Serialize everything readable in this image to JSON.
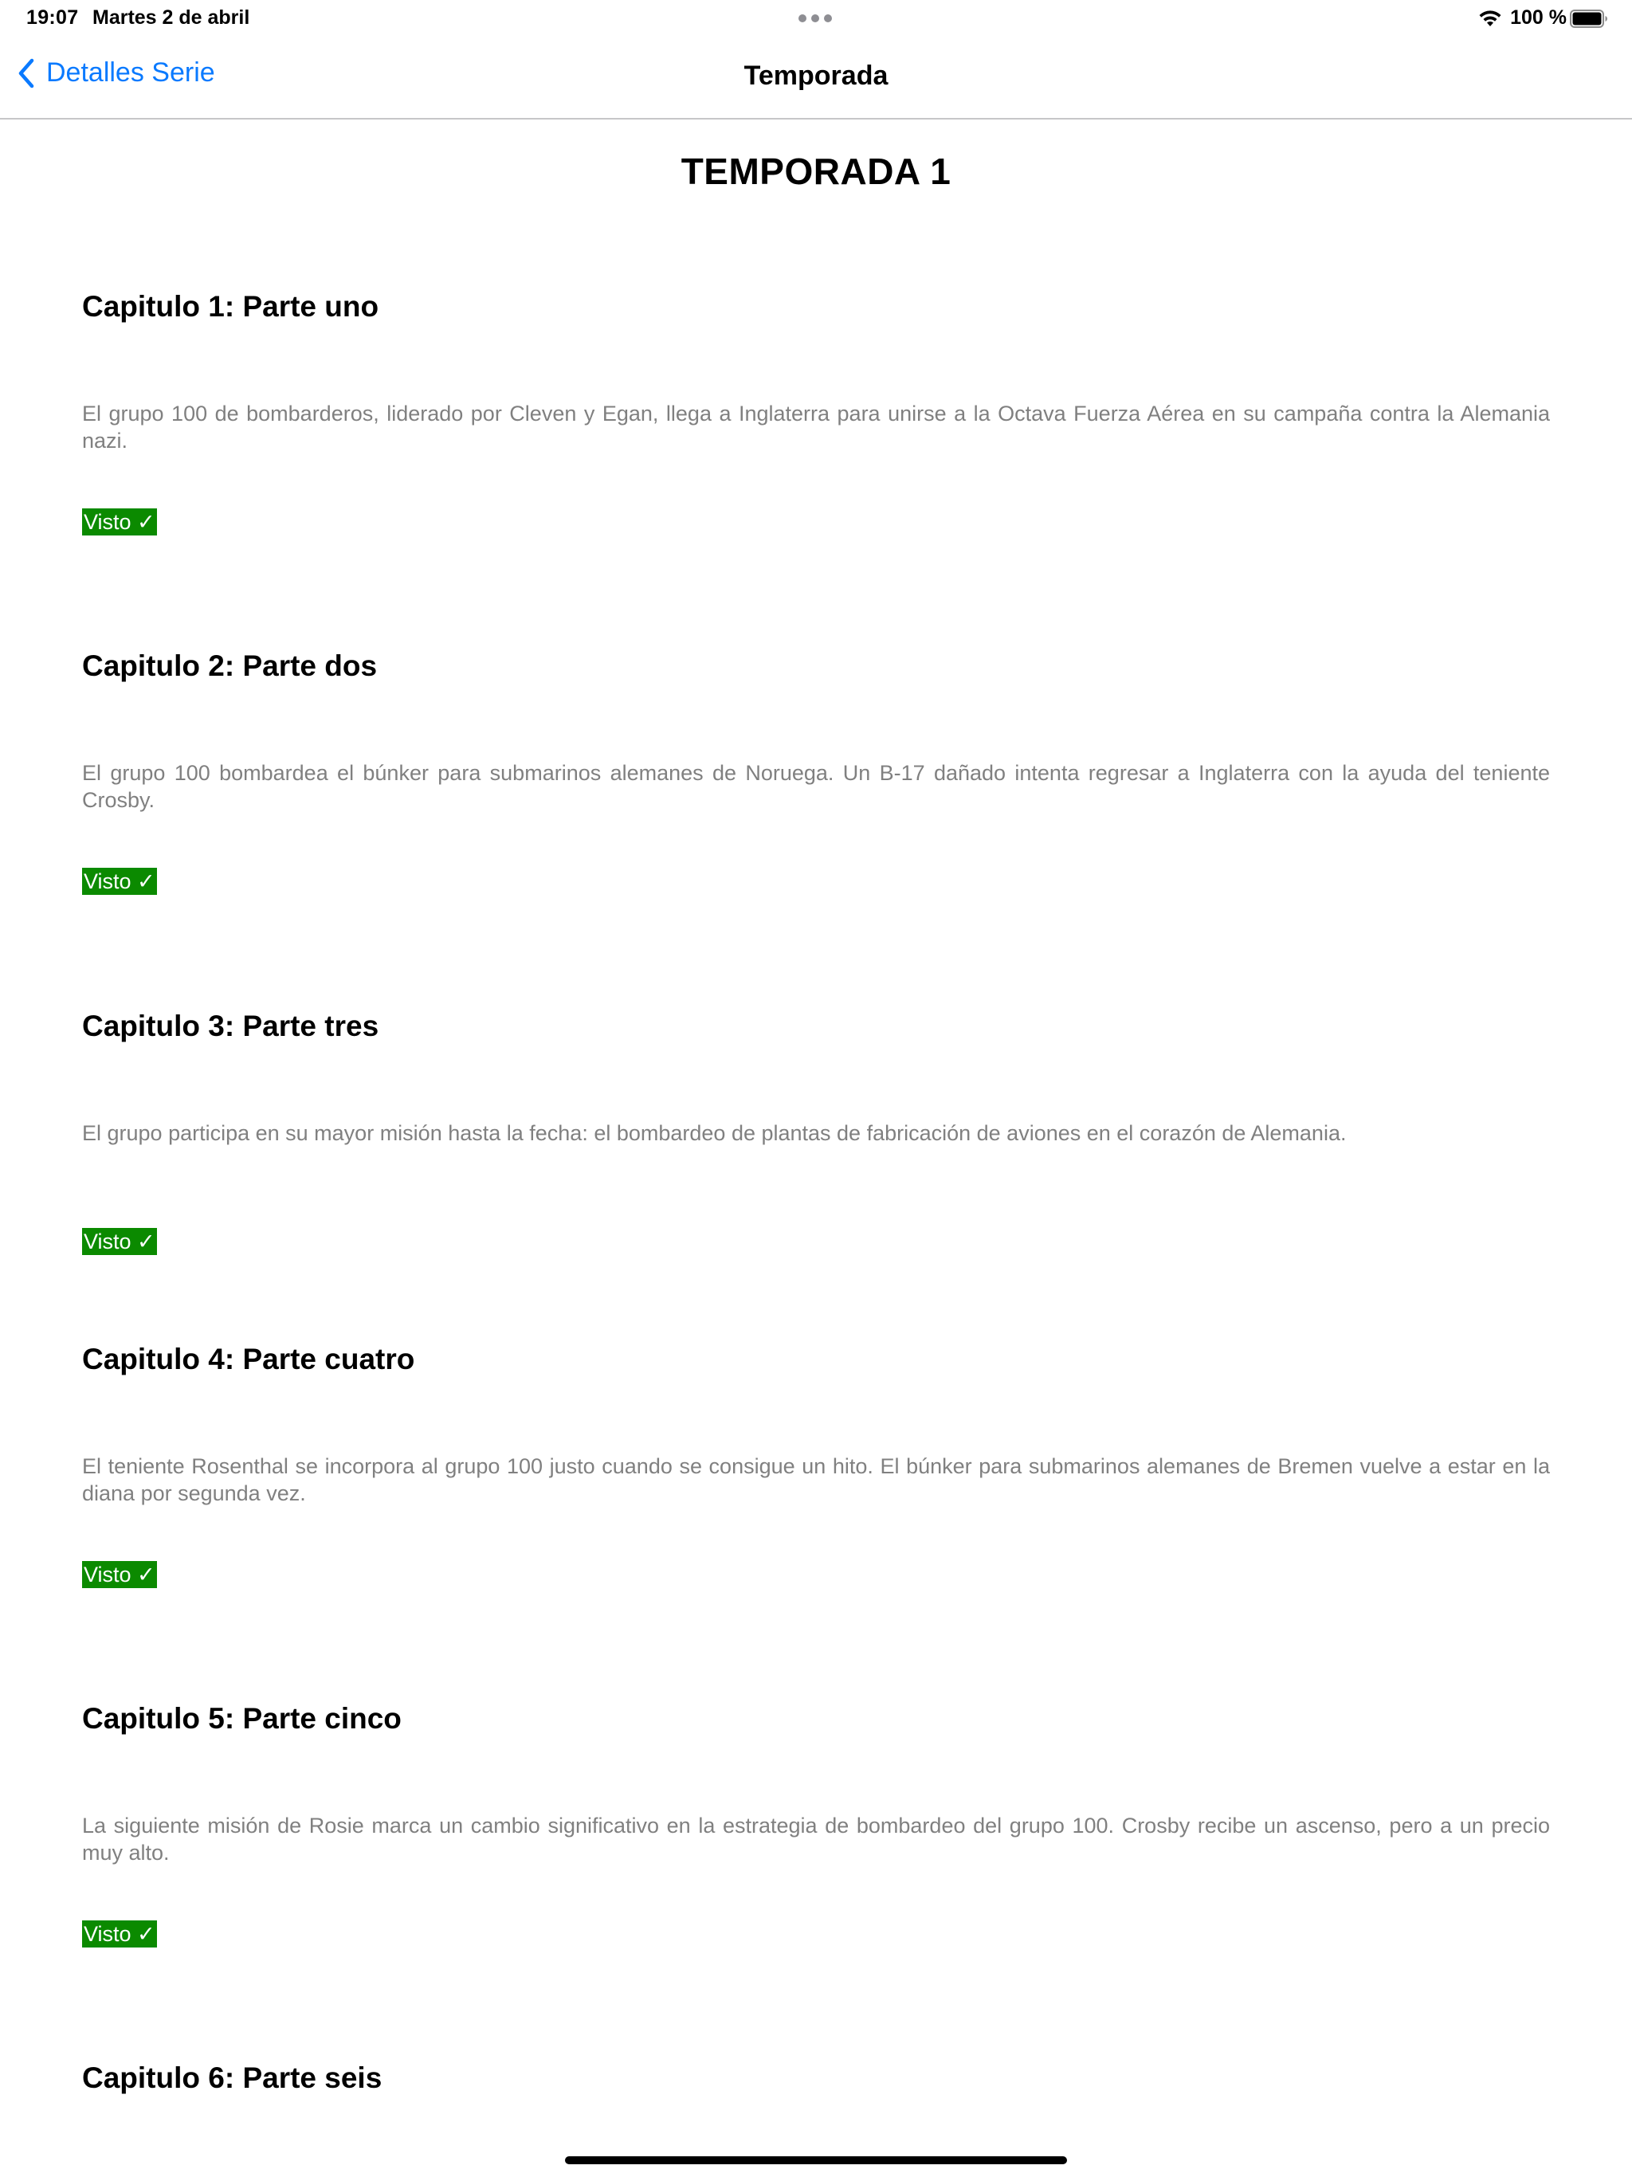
{
  "status_bar": {
    "time": "19:07",
    "date": "Martes 2 de abril",
    "battery_text": "100 %"
  },
  "nav": {
    "back_label": "Detalles Serie",
    "title": "Temporada"
  },
  "season_title": "TEMPORADA 1",
  "episodes": [
    {
      "title": "Capitulo 1: Parte uno",
      "description": "El grupo 100 de bombarderos, liderado por Cleven y Egan, llega a Inglaterra para unirse a la Octava Fuerza Aérea en su campaña contra la Alemania nazi.",
      "badge": "Visto ✓"
    },
    {
      "title": "Capitulo 2: Parte dos",
      "description": "El grupo 100 bombardea el búnker para submarinos alemanes de Noruega. Un B-17 dañado intenta regresar a Inglaterra con la ayuda del teniente Crosby.",
      "badge": "Visto ✓"
    },
    {
      "title": "Capitulo 3: Parte tres",
      "description": "El grupo participa en su mayor misión hasta la fecha: el bombardeo de plantas de fabricación de aviones en el corazón de Alemania.",
      "badge": "Visto ✓"
    },
    {
      "title": "Capitulo 4: Parte cuatro",
      "description": "El teniente Rosenthal se incorpora al grupo 100 justo cuando se consigue un hito. El búnker para submarinos alemanes de Bremen vuelve a estar en la diana por segunda vez.",
      "badge": "Visto ✓"
    },
    {
      "title": "Capitulo 5: Parte cinco",
      "description": "La siguiente misión de Rosie marca un cambio significativo en la estrategia de bombardeo del grupo 100. Crosby recibe un ascenso, pero a un precio muy alto.",
      "badge": "Visto ✓"
    },
    {
      "title": "Capitulo 6: Parte seis"
    }
  ]
}
